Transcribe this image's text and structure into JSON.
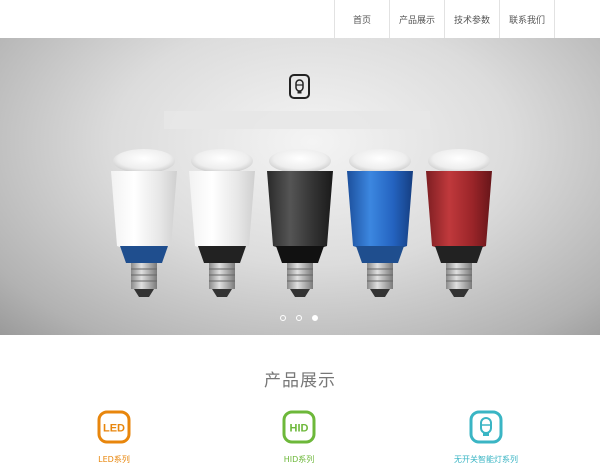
{
  "nav": {
    "items": [
      {
        "label": "首页"
      },
      {
        "label": "产品展示"
      },
      {
        "label": "技术参数"
      },
      {
        "label": "联系我们"
      }
    ]
  },
  "banner": {
    "logo_icon": "bulb-badge-icon",
    "bulbs": [
      {
        "color": "white"
      },
      {
        "color": "white"
      },
      {
        "color": "black"
      },
      {
        "color": "blue"
      },
      {
        "color": "red"
      }
    ],
    "slides_total": 3,
    "active_slide": 3
  },
  "products": {
    "title": "产品展示",
    "items": [
      {
        "label": "LED系列",
        "icon_text": "LED",
        "color": "#e8860c"
      },
      {
        "label": "HID系列",
        "icon_text": "HID",
        "color": "#6db83a"
      },
      {
        "label": "无开关智能灯系列",
        "icon": "bulb-badge-icon",
        "color": "#3ab5c4"
      }
    ]
  }
}
